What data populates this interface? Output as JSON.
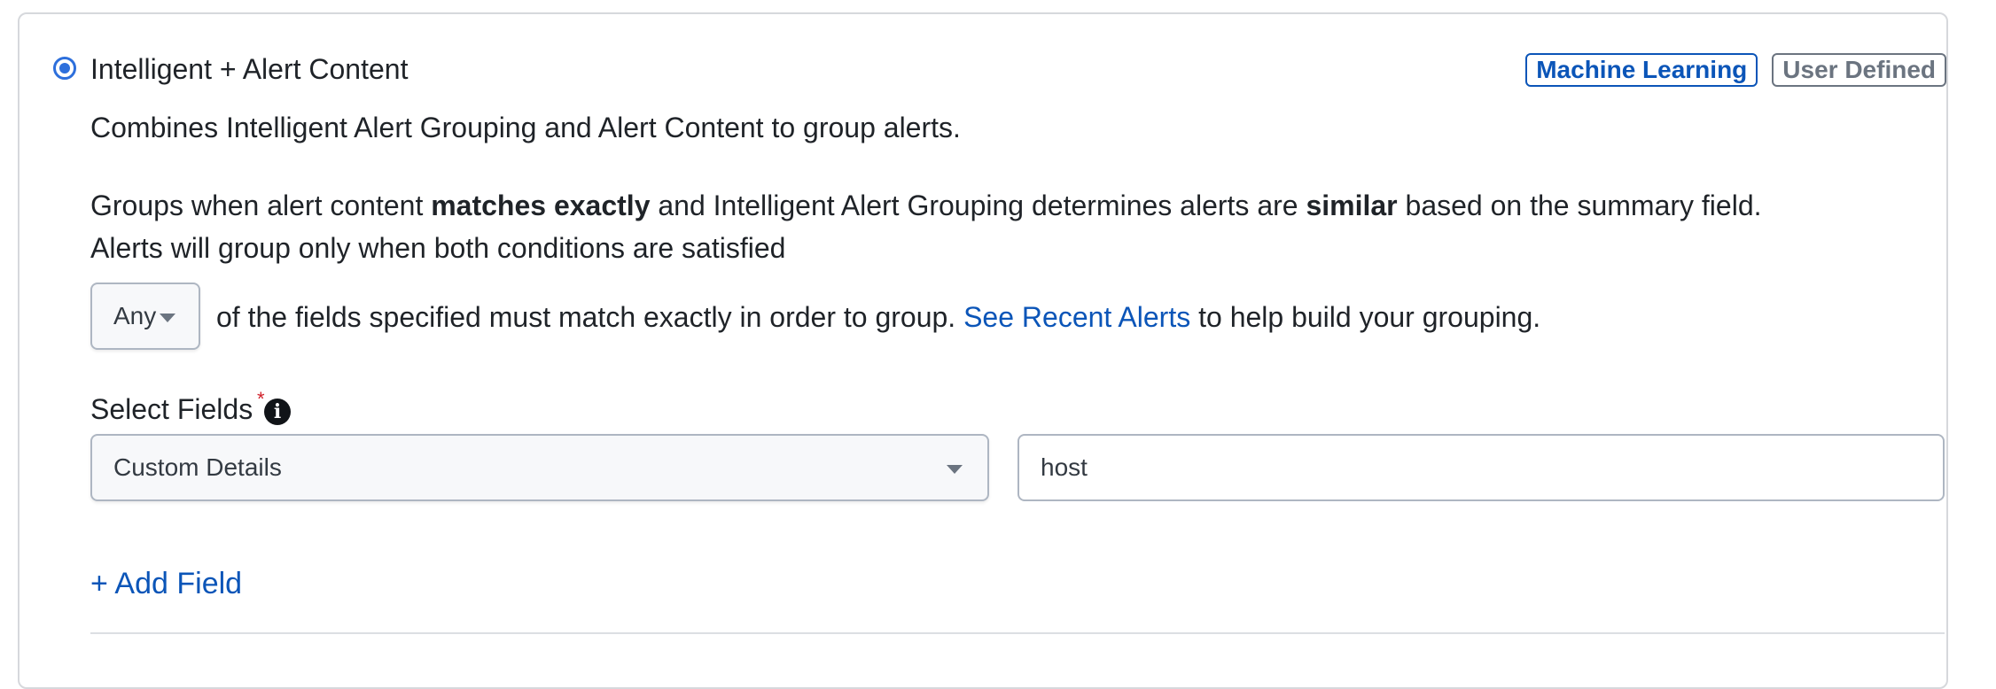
{
  "option": {
    "title": "Intelligent + Alert Content",
    "selected": true,
    "description": "Combines Intelligent Alert Grouping and Alert Content to group alerts."
  },
  "badges": {
    "machine_learning": "Machine Learning",
    "user_defined": "User Defined"
  },
  "rule": {
    "line1_part1": "Groups when alert content ",
    "line1_bold1": "matches exactly",
    "line1_part2": " and Intelligent Alert Grouping determines alerts are ",
    "line1_bold2": "similar",
    "line1_part3": " based on the summary field.",
    "line2": "Alerts will group only when both conditions are satisfied"
  },
  "match_mode": {
    "selected": "Any",
    "sentence_before": " of the fields specified must match exactly in order to group. ",
    "link_text": "See Recent Alerts",
    "sentence_after": " to help build your grouping."
  },
  "fields": {
    "label": "Select Fields",
    "required_marker": "*",
    "info_glyph": "i",
    "field_type": "Custom Details",
    "field_value": "host",
    "add_field": "+ Add Field"
  },
  "colors": {
    "accent": "#2d6fdc",
    "link": "#0b55b8",
    "muted_badge": "#6b7480",
    "required": "#d0202a"
  }
}
